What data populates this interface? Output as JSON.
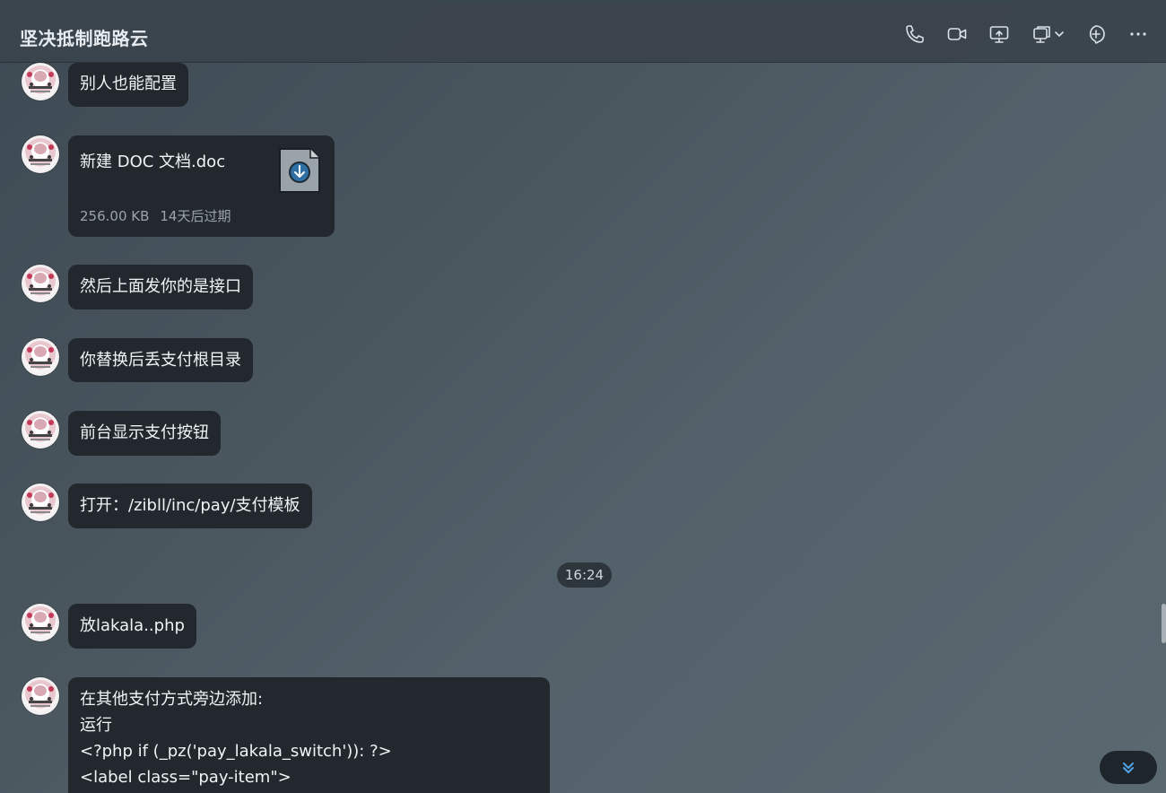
{
  "header": {
    "title": "坚决抵制跑路云",
    "icons": [
      "phone-icon",
      "video-icon",
      "screen-share-icon",
      "window-switch-icon",
      "add-member-icon",
      "more-icon"
    ]
  },
  "messages": [
    {
      "text": "别人也能配置"
    },
    {
      "file": {
        "name": "新建 DOC 文档.doc",
        "size": "256.00 KB",
        "expiry": "14天后过期"
      }
    },
    {
      "text": "然后上面发你的是接口"
    },
    {
      "text": "你替换后丢支付根目录"
    },
    {
      "text": "前台显示支付按钮"
    },
    {
      "text": "打开：/zibll/inc/pay/支付模板"
    },
    {
      "text": "放lakala..php"
    },
    {
      "lines": [
        "在其他支付方式旁边添加:",
        "运行",
        "<?php if (_pz('pay_lakala_switch')): ?>",
        "<label class=\"pay-item\">"
      ]
    }
  ],
  "timestamp": "16:24",
  "colors": {
    "bubble": "#22282d",
    "background": "#4a565e",
    "accent": "#4fa3e6"
  }
}
